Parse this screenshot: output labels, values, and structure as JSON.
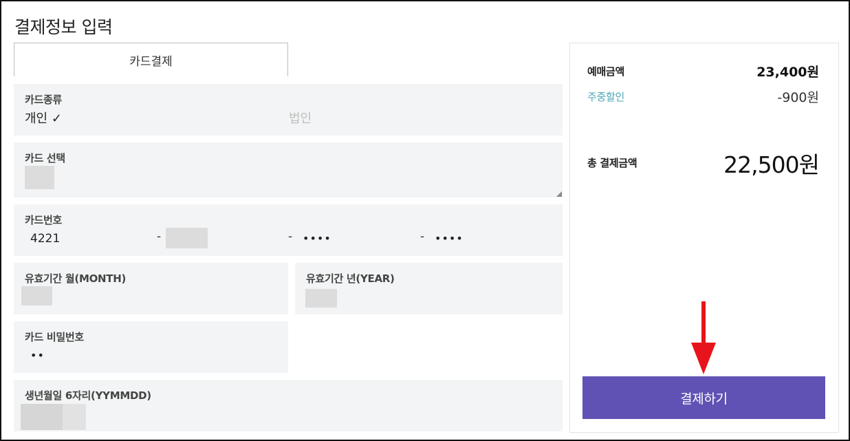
{
  "page": {
    "title": "결제정보 입력"
  },
  "tabs": [
    {
      "label": "카드결제"
    }
  ],
  "form": {
    "card_type": {
      "label": "카드종류",
      "personal": "개인 ✓",
      "corporate": "법인"
    },
    "card_select": {
      "label": "카드 선택"
    },
    "card_number": {
      "label": "카드번호",
      "part1": "4221",
      "sep": "-",
      "part3": "••••",
      "part4": "••••"
    },
    "expiry_month": {
      "label": "유효기간 월(MONTH)"
    },
    "expiry_year": {
      "label": "유효기간 년(YEAR)"
    },
    "card_password": {
      "label": "카드 비밀번호",
      "value": "••"
    },
    "birth": {
      "label": "생년월일 6자리(YYMMDD)"
    }
  },
  "summary": {
    "ticket_label": "예매금액",
    "ticket_value": "23,400원",
    "discount_label": "주중할인",
    "discount_value": "-900원",
    "total_label": "총 결제금액",
    "total_value": "22,500원"
  },
  "pay_button": {
    "label": "결제하기"
  },
  "colors": {
    "accent": "#5f52b4",
    "discount": "#4aa6b6",
    "arrow": "#e8141b",
    "panel_bg": "#f3f4f5"
  }
}
